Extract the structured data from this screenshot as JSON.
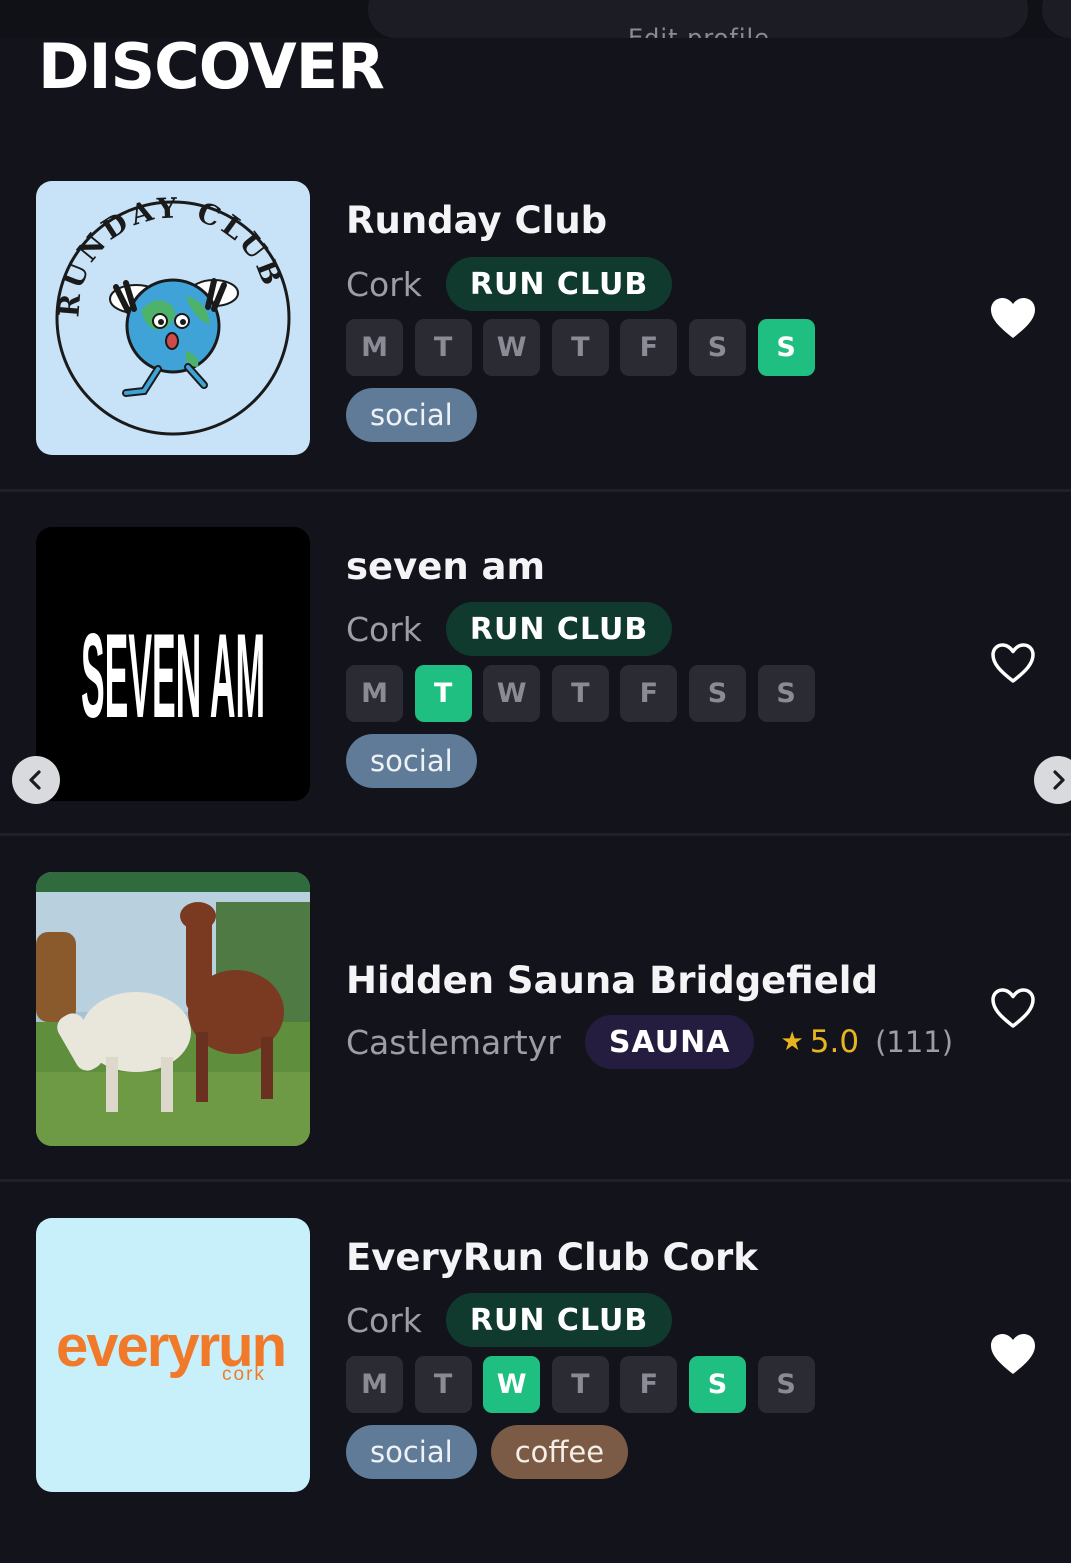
{
  "header": {
    "edit_profile_label": "Edit profile",
    "title": "DISCOVER"
  },
  "listings": [
    {
      "name": "Runday Club",
      "location": "Cork",
      "category": "RUN CLUB",
      "thumbnail_text": "RUNDAY CLUB",
      "days": [
        {
          "label": "M",
          "active": false
        },
        {
          "label": "T",
          "active": false
        },
        {
          "label": "W",
          "active": false
        },
        {
          "label": "T",
          "active": false
        },
        {
          "label": "F",
          "active": false
        },
        {
          "label": "S",
          "active": false
        },
        {
          "label": "S",
          "active": true
        }
      ],
      "tags": [
        "social"
      ],
      "favorited": true
    },
    {
      "name": "seven am",
      "location": "Cork",
      "category": "RUN CLUB",
      "thumbnail_text": "SEVEN AM",
      "days": [
        {
          "label": "M",
          "active": false
        },
        {
          "label": "T",
          "active": true
        },
        {
          "label": "W",
          "active": false
        },
        {
          "label": "T",
          "active": false
        },
        {
          "label": "F",
          "active": false
        },
        {
          "label": "S",
          "active": false
        },
        {
          "label": "S",
          "active": false
        }
      ],
      "tags": [
        "social"
      ],
      "favorited": false
    },
    {
      "name": "Hidden Sauna Bridgefield",
      "location": "Castlemartyr",
      "category": "SAUNA",
      "rating": {
        "star_icon": "star-icon",
        "score": "5.0",
        "count": "(111)"
      },
      "favorited": false
    },
    {
      "name": "EveryRun Club Cork",
      "location": "Cork",
      "category": "RUN CLUB",
      "thumbnail_text": "everyrun",
      "thumbnail_subtext": "cork",
      "days": [
        {
          "label": "M",
          "active": false
        },
        {
          "label": "T",
          "active": false
        },
        {
          "label": "W",
          "active": true
        },
        {
          "label": "T",
          "active": false
        },
        {
          "label": "F",
          "active": false
        },
        {
          "label": "S",
          "active": true
        },
        {
          "label": "S",
          "active": false
        }
      ],
      "tags": [
        "social",
        "coffee"
      ],
      "favorited": true
    }
  ],
  "colors": {
    "background": "#13141b",
    "day_active": "#1fbf82",
    "run_club_chip": "#103a2e",
    "sauna_chip": "#251d40",
    "social_tag": "#5f7b97",
    "coffee_tag": "#7b5b45",
    "rating": "#e8b41f"
  },
  "carousel": {
    "prev_icon": "chevron-left-icon",
    "next_icon": "chevron-right-icon"
  }
}
